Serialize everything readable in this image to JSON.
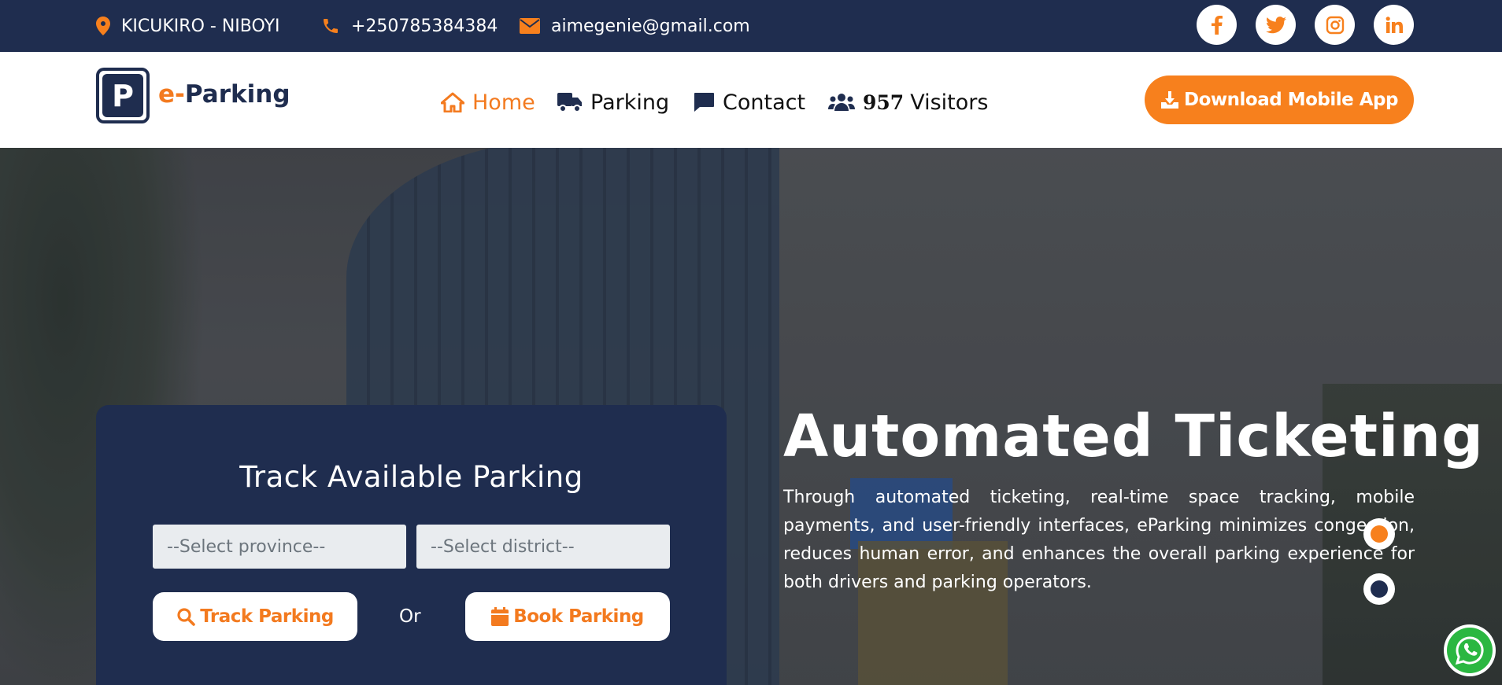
{
  "topbar": {
    "location": "KICUKIRO - NIBOYI",
    "phone": "+250785384384",
    "email": "aimegenie@gmail.com",
    "social": [
      "facebook-icon",
      "twitter-icon",
      "instagram-icon",
      "linkedin-icon"
    ]
  },
  "logo": {
    "prefix": "e-",
    "name": "Parking",
    "mark": "P"
  },
  "nav": {
    "home": "Home",
    "parking": "Parking",
    "contact": "Contact",
    "visitors_count": "957",
    "visitors_label": "Visitors",
    "download": "Download Mobile App"
  },
  "track": {
    "title": "Track Available Parking",
    "province_placeholder": "--Select province--",
    "district_placeholder": "--Select district--",
    "track_button": "Track Parking",
    "or": "Or",
    "book_button": "Book Parking"
  },
  "hero": {
    "title": "Automated Ticketing",
    "description": "Through automated ticketing, real-time space tracking, mobile payments, and user-friendly interfaces, eParking minimizes congestion, reduces human error, and enhances the overall parking experience for both drivers and parking operators."
  },
  "colors": {
    "primary": "#1f2d4f",
    "accent": "#f7801d"
  }
}
